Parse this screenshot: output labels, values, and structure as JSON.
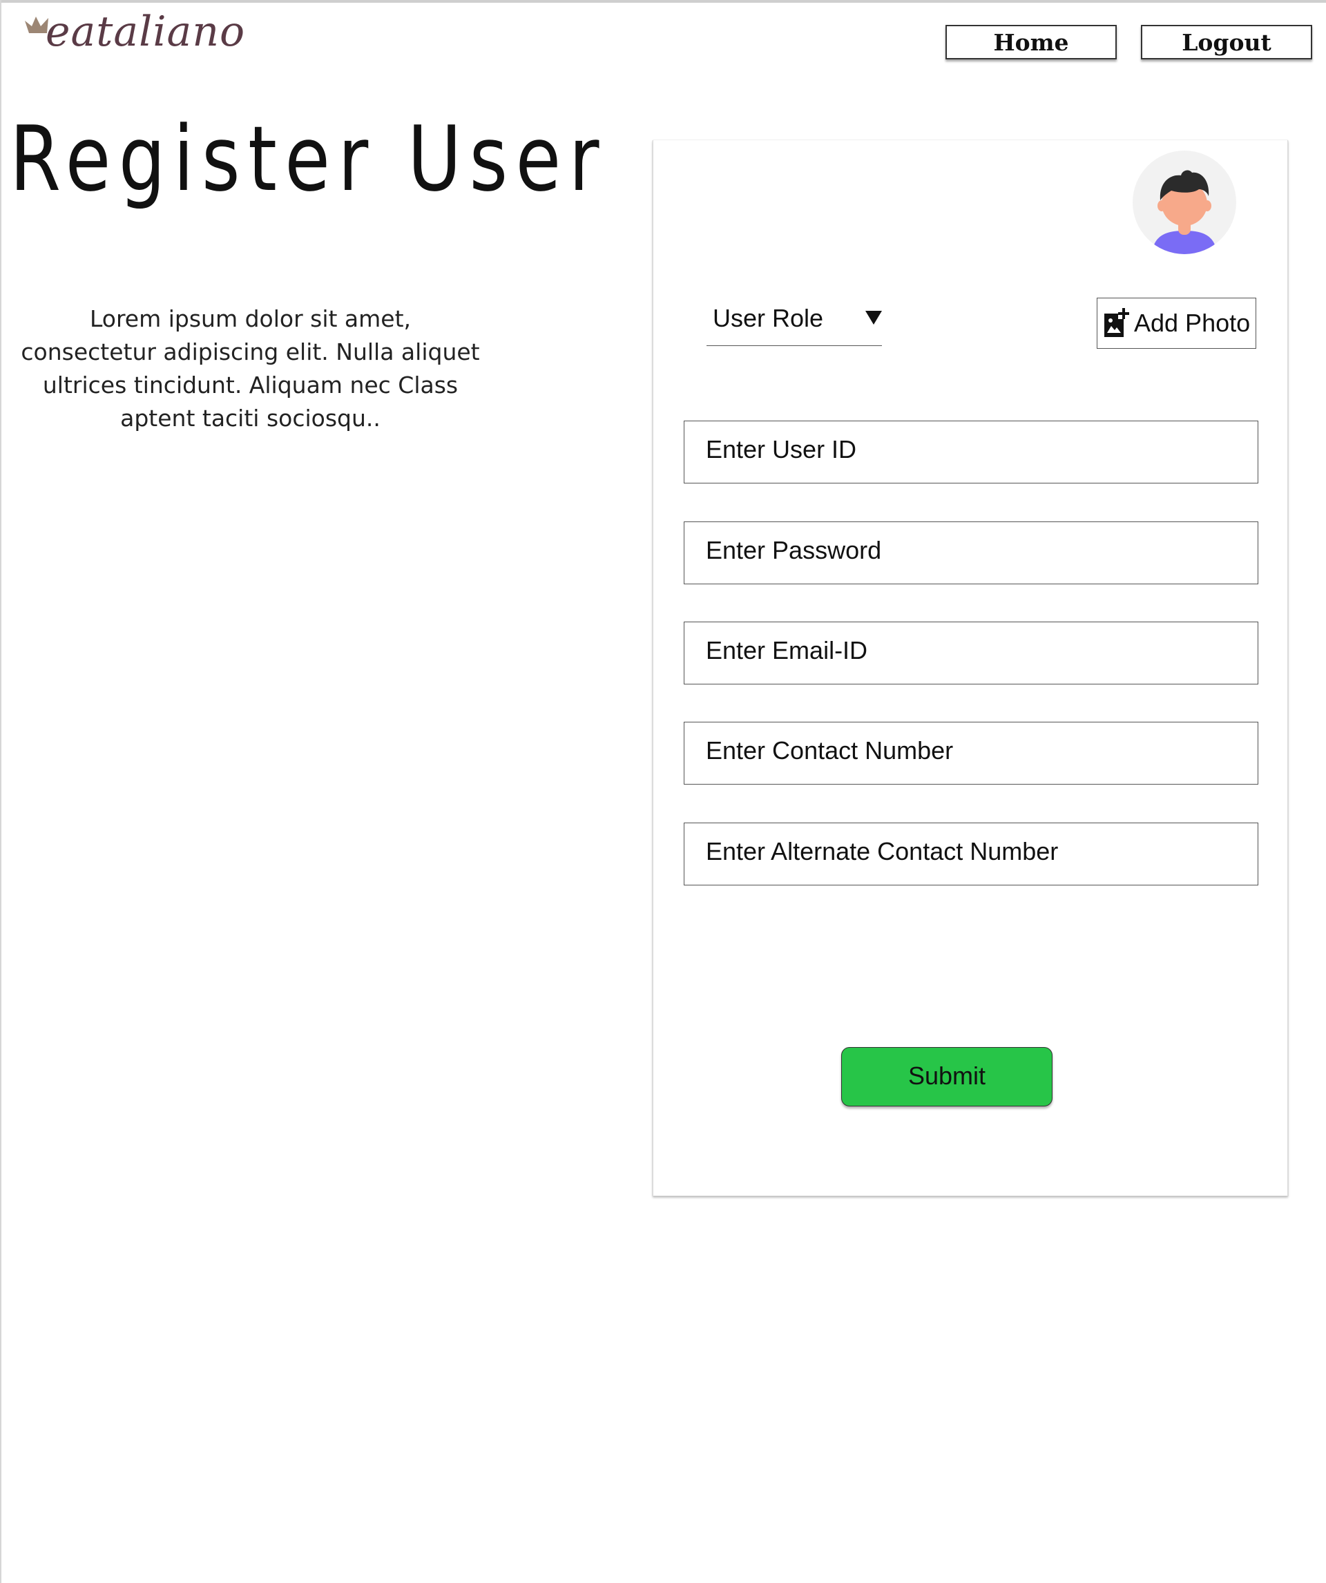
{
  "header": {
    "logo_text": "eataliano",
    "nav": {
      "home_label": "Home",
      "logout_label": "Logout"
    }
  },
  "intro": {
    "title": "Register User",
    "description": "Lorem ipsum dolor sit amet, consectetur adipiscing elit. Nulla aliquet ultrices tincidunt. Aliquam nec Class aptent taciti sociosqu.."
  },
  "form": {
    "avatar_icon": "user-avatar-icon",
    "role_select": {
      "label": "User Role",
      "icon": "caret-down-icon"
    },
    "add_photo": {
      "label": "Add Photo",
      "icon": "add-photo-icon"
    },
    "fields": [
      {
        "placeholder": "Enter User ID"
      },
      {
        "placeholder": "Enter Password"
      },
      {
        "placeholder": "Enter Email-ID"
      },
      {
        "placeholder": "Enter Contact Number"
      },
      {
        "placeholder": "Enter Alternate Contact Number"
      }
    ],
    "submit_label": "Submit"
  },
  "colors": {
    "submit_green": "#27c548",
    "logo_text": "#5a3b46",
    "logo_crown": "#9c8674",
    "avatar_bg": "#f2f2f2",
    "avatar_shirt": "#7a6cf5",
    "avatar_skin": "#f7a98a",
    "avatar_hair": "#2b2b2b"
  }
}
